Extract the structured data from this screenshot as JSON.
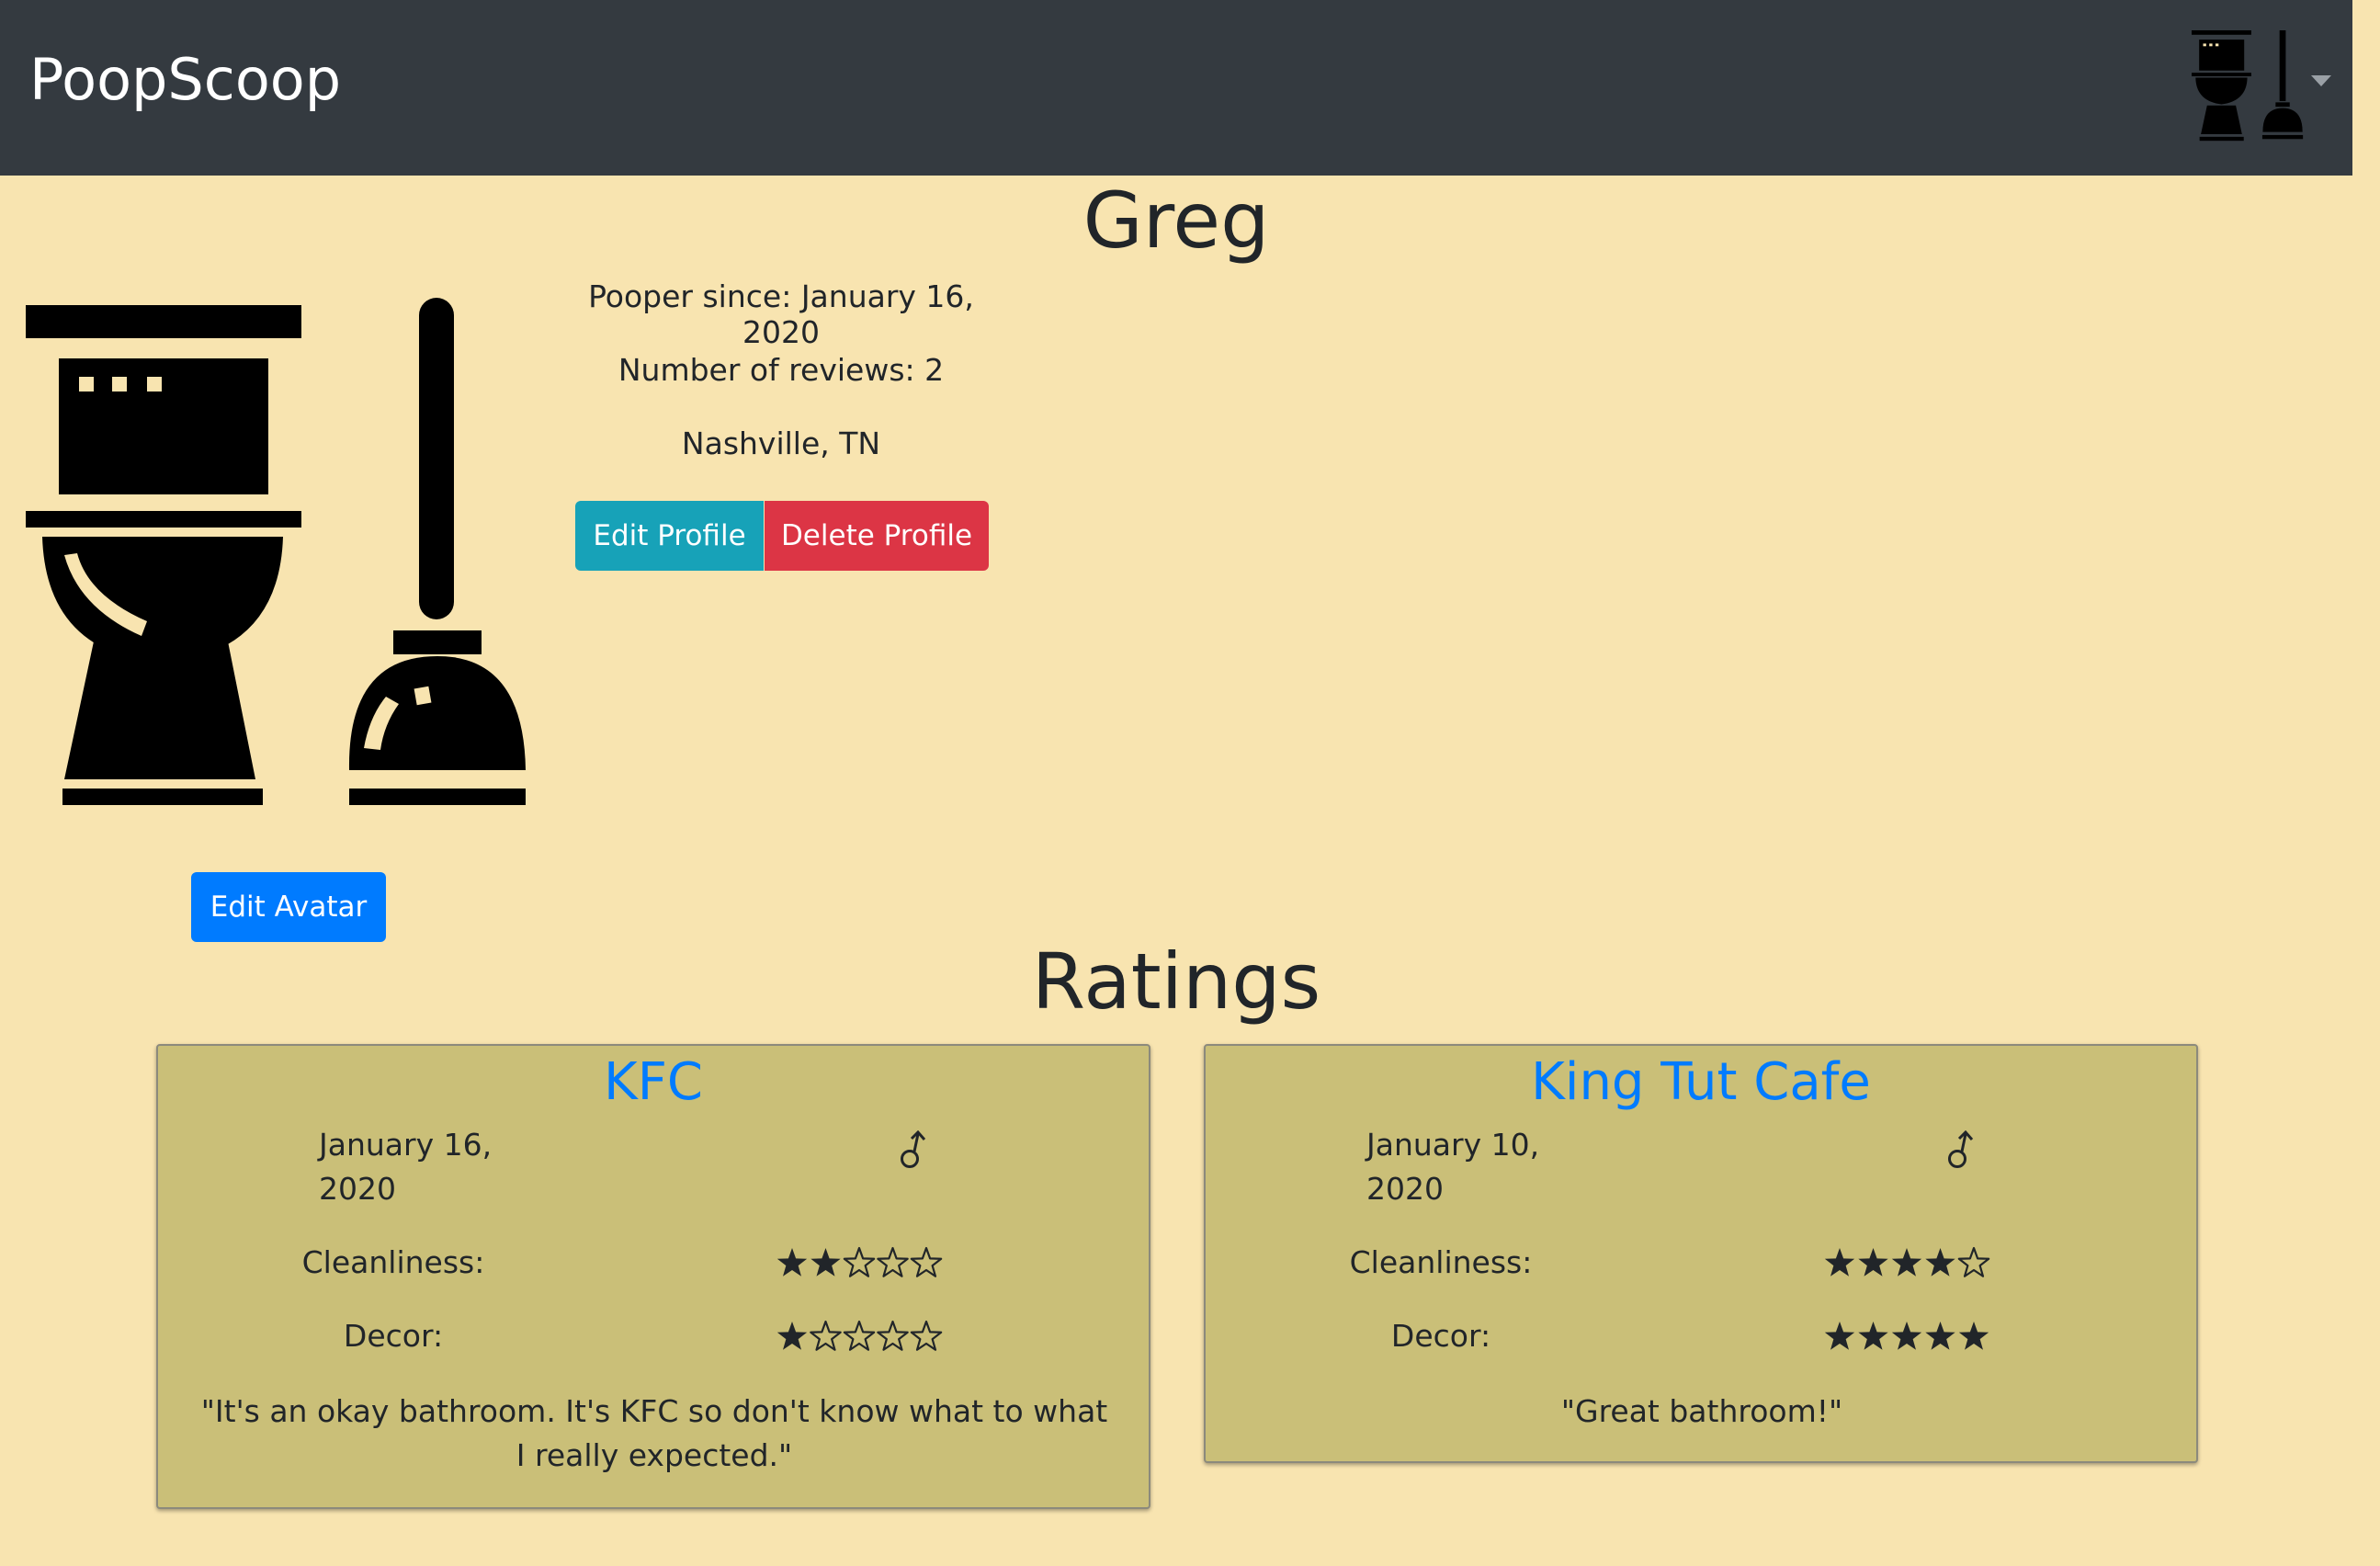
{
  "app": {
    "brand": "PoopScoop"
  },
  "profile": {
    "name": "Greg",
    "since": "Pooper since: January 16, 2020",
    "reviews": "Number of reviews: 2",
    "location": "Nashville, TN",
    "edit_profile_label": "Edit Profile",
    "delete_profile_label": "Delete Profile",
    "edit_avatar_label": "Edit Avatar"
  },
  "ratings": {
    "title": "Ratings",
    "items": [
      {
        "place": "KFC",
        "date": "January 16, 2020",
        "gender_icon": "male-symbol-icon",
        "cleanliness_label": "Cleanliness:",
        "cleanliness": 2,
        "decor_label": "Decor:",
        "decor": 1,
        "comment": "\"It's an okay bathroom. It's KFC so don't know what to what I really expected.\""
      },
      {
        "place": "King Tut Cafe",
        "date": "January 10, 2020",
        "gender_icon": "male-symbol-icon",
        "cleanliness_label": "Cleanliness:",
        "cleanliness": 4,
        "decor_label": "Decor:",
        "decor": 5,
        "comment": "\"Great bathroom!\""
      }
    ]
  },
  "colors": {
    "navbar": "#343a40",
    "page_bg": "#f8e4b0",
    "card_bg": "#cabf78",
    "link": "#007bff",
    "info_button": "#17a2b8",
    "danger_button": "#dc3545"
  }
}
